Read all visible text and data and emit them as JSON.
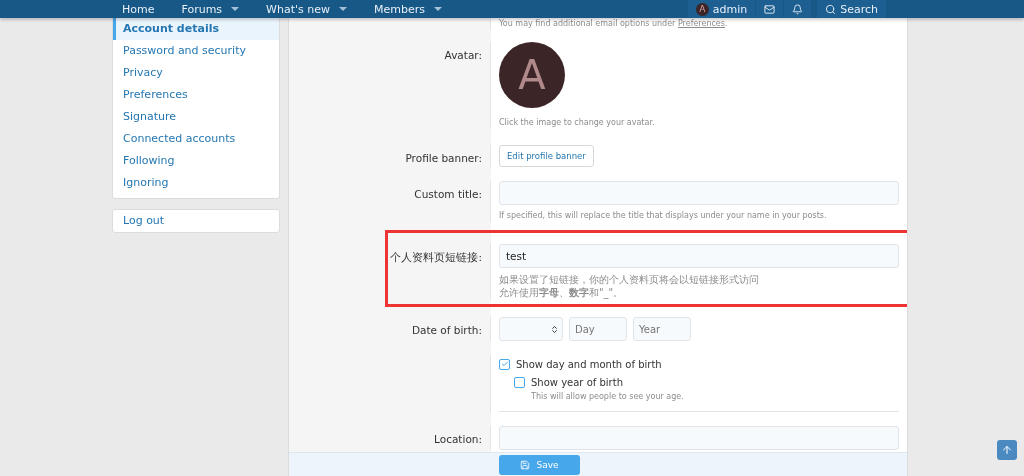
{
  "nav": {
    "items": [
      {
        "label": "Home",
        "dropdown": false
      },
      {
        "label": "Forums",
        "dropdown": true
      },
      {
        "label": "What's new",
        "dropdown": true
      },
      {
        "label": "Members",
        "dropdown": true
      }
    ],
    "user_initial": "A",
    "user": "admin",
    "search": "Search"
  },
  "sidebar": {
    "items": [
      {
        "label": "Account details",
        "selected": true
      },
      {
        "label": "Password and security",
        "selected": false
      },
      {
        "label": "Privacy",
        "selected": false
      },
      {
        "label": "Preferences",
        "selected": false
      },
      {
        "label": "Signature",
        "selected": false
      },
      {
        "label": "Connected accounts",
        "selected": false
      },
      {
        "label": "Following",
        "selected": false
      },
      {
        "label": "Ignoring",
        "selected": false
      }
    ],
    "logout": "Log out"
  },
  "form": {
    "rows": [
      {
        "kind": "note",
        "text": "You may find additional email options under ",
        "link": "Preferences",
        "after": "."
      },
      {
        "kind": "avatar",
        "label": "Avatar:",
        "initial": "A",
        "hints": [
          "Click the image to change your avatar."
        ]
      },
      {
        "kind": "button",
        "label": "Profile banner:",
        "button": "Edit profile banner"
      },
      {
        "kind": "text",
        "label": "Custom title:",
        "hints": [
          "If specified, this will replace the title that displays under your name in your posts."
        ],
        "highlighted": false
      },
      {
        "kind": "text",
        "label": "个人资料页短链接:",
        "value": "test",
        "hints": [
          "如果设置了短链接，你的个人资料页将会以短链接形式访问",
          "允许使用**字母**、**数字**和\"_\"。"
        ],
        "highlighted": true
      },
      {
        "kind": "date",
        "label": "Date of birth:",
        "day_placeholder": "Day",
        "year_placeholder": "Year"
      },
      {
        "kind": "checks",
        "checks": [
          {
            "label": "Show day and month of birth",
            "checked": true,
            "children": [
              {
                "label": "Show year of birth",
                "checked": false,
                "hint": "This will allow people to see your age."
              }
            ]
          }
        ]
      },
      {
        "kind": "text",
        "label": "Location:",
        "highlighted": false
      }
    ],
    "save": "Save"
  }
}
